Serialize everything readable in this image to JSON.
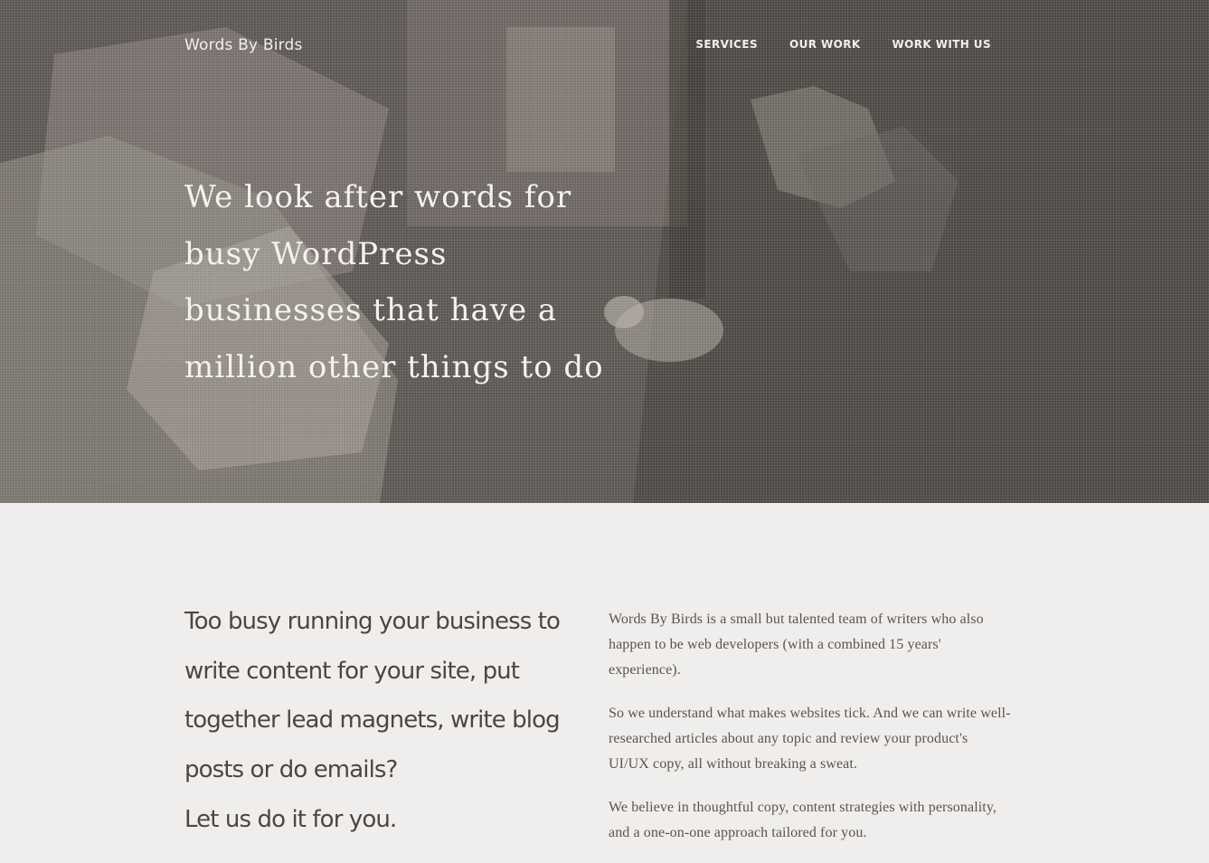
{
  "header": {
    "site_title": "Words By Birds",
    "nav": [
      {
        "label": "SERVICES"
      },
      {
        "label": "OUR WORK"
      },
      {
        "label": "WORK WITH US"
      }
    ]
  },
  "hero": {
    "heading": "We look after words for busy WordPress businesses that have a million other things to do"
  },
  "intro": {
    "heading": "Too busy running your business to write content for your site, put together lead magnets, write blog posts or do emails?",
    "cta": "Let us do it for you.",
    "paragraphs": [
      "Words By Birds is a small but talented team of writers who also happen to be web developers (with a combined 15 years' experience).",
      "So we understand what makes websites tick. And we can write well-researched articles about any topic and review your product's UI/UX copy, all without breaking a sweat.",
      "We believe in thoughtful copy, content strategies with personality, and a one-on-one approach tailored for you."
    ]
  },
  "colors": {
    "hero_overlay": "#4f4a46",
    "page_background": "#efeeec",
    "text_dark": "#4c4642",
    "text_light": "#f2f0ec"
  }
}
